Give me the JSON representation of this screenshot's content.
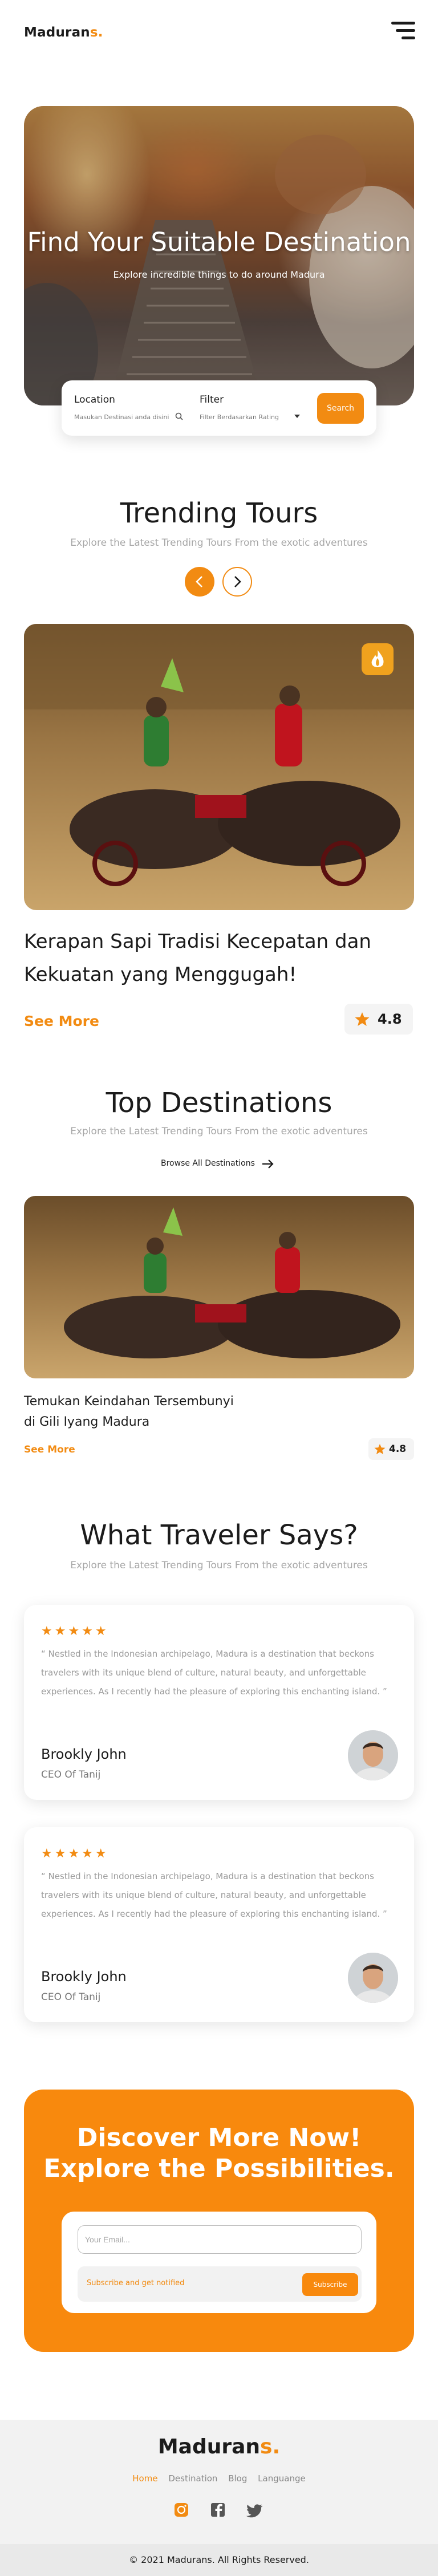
{
  "header": {
    "logo_main": "Maduran",
    "logo_accent": "s.",
    "menu_icon": "hamburger-menu-icon"
  },
  "hero": {
    "title": "Find Your Suitable Destination",
    "subtitle": "Explore incredible things to do around Madura",
    "search": {
      "location_label": "Location",
      "location_placeholder": "Masukan Destinasi anda disini",
      "filter_label": "Filter",
      "filter_value": "Filter Berdasarkan Rating",
      "button_label": "Search"
    }
  },
  "trending": {
    "title": "Trending Tours",
    "subtitle": "Explore the Latest Trending Tours From the exotic adventures",
    "prev_icon": "chevron-left-icon",
    "next_icon": "chevron-right-icon",
    "card": {
      "title": "Kerapan Sapi Tradisi Kecepatan dan Kekuatan yang Menggugah!",
      "see_more": "See More",
      "rating": "4.8",
      "badge_icon": "fire-icon"
    }
  },
  "destinations": {
    "title": "Top Destinations",
    "subtitle": "Explore the Latest Trending Tours From the exotic adventures",
    "browse_label": "Browse All Destinations",
    "card": {
      "title_line1": "Temukan Keindahan Tersembunyi",
      "title_line2": "di Gili Iyang Madura",
      "see_more": "See More",
      "rating": "4.8"
    }
  },
  "testimonials": {
    "title": "What Traveler Says?",
    "subtitle": "Explore the Latest Trending Tours From the exotic adventures",
    "items": [
      {
        "stars": "★★★★★",
        "quote": "“ Nestled in the Indonesian archipelago, Madura is a destination that beckons travelers with its unique blend of culture, natural beauty, and unforgettable experiences. As I recently had the pleasure of exploring this enchanting island. ”",
        "name": "Brookly John",
        "role": "CEO Of Tanij"
      },
      {
        "stars": "★★★★★",
        "quote": "“ Nestled in the Indonesian archipelago, Madura is a destination that beckons travelers with its unique blend of culture, natural beauty, and unforgettable experiences. As I recently had the pleasure of exploring this enchanting island. ”",
        "name": "Brookly John",
        "role": "CEO Of Tanij"
      }
    ]
  },
  "cta": {
    "title_line1": "Discover More Now!",
    "title_line2": "Explore the Possibilities.",
    "email_placeholder": "Your Email...",
    "notify_text": "Subscribe and get notified",
    "subscribe_label": "Subscribe"
  },
  "footer": {
    "logo_main": "Maduran",
    "logo_accent": "s.",
    "nav": [
      "Home",
      "Destination",
      "Blog",
      "Languange"
    ],
    "active_nav": "Home",
    "socials": [
      "instagram-icon",
      "facebook-icon",
      "twitter-icon"
    ],
    "copyright": "© 2021 Madurans. All Rights Reserved."
  },
  "colors": {
    "accent": "#f28b12",
    "text": "#1b1b1b",
    "muted": "#a7a7a7",
    "footer_bg": "#f2f2f2"
  }
}
